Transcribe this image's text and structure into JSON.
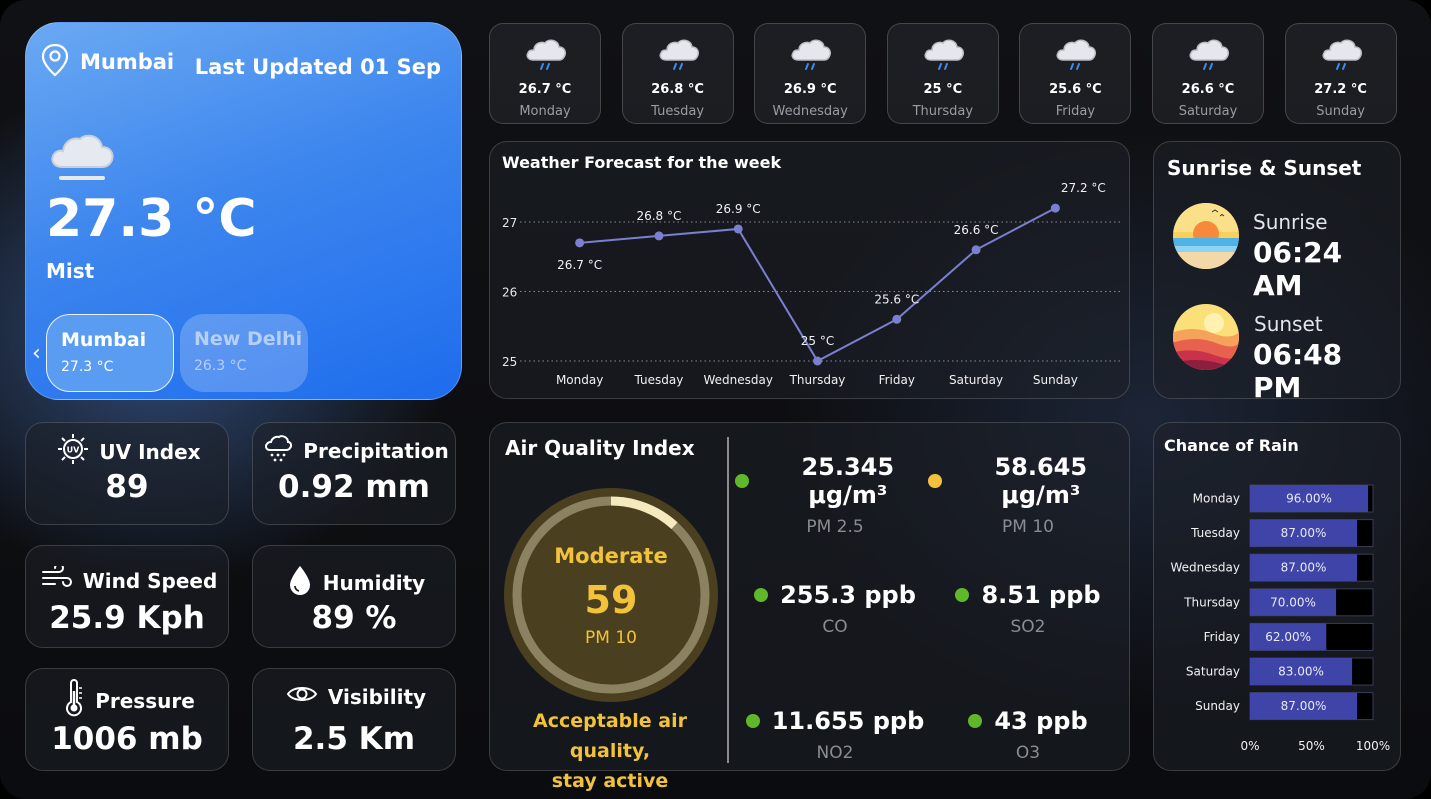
{
  "hero": {
    "location": "Mumbai",
    "last_updated": "Last Updated 01 Sep",
    "temperature": "27.3 °C",
    "condition": "Mist",
    "cities": [
      {
        "name": "Mumbai",
        "temp": "27.3 °C"
      },
      {
        "name": "New Delhi",
        "temp": "26.3 °C"
      }
    ]
  },
  "days": [
    {
      "day": "Monday",
      "temp": "26.7 °C"
    },
    {
      "day": "Tuesday",
      "temp": "26.8 °C"
    },
    {
      "day": "Wednesday",
      "temp": "26.9 °C"
    },
    {
      "day": "Thursday",
      "temp": "25 °C"
    },
    {
      "day": "Friday",
      "temp": "25.6 °C"
    },
    {
      "day": "Saturday",
      "temp": "26.6 °C"
    },
    {
      "day": "Sunday",
      "temp": "27.2 °C"
    }
  ],
  "forecast": {
    "title": "Weather Forecast for the week"
  },
  "sun": {
    "title": "Sunrise & Sunset",
    "sunrise_label": "Sunrise",
    "sunrise_time": "06:24 AM",
    "sunset_label": "Sunset",
    "sunset_time": "06:48 PM"
  },
  "stats": {
    "uv": {
      "label": "UV Index",
      "value": "89"
    },
    "precip": {
      "label": "Precipitation",
      "value": "0.92 mm"
    },
    "wind": {
      "label": "Wind Speed",
      "value": "25.9 Kph"
    },
    "humidity": {
      "label": "Humidity",
      "value": "89 %"
    },
    "pressure": {
      "label": "Pressure",
      "value": "1006 mb"
    },
    "visibility": {
      "label": "Visibility",
      "value": "2.5 Km"
    }
  },
  "aqi": {
    "title": "Air Quality Index",
    "level": "Moderate",
    "value": "59",
    "pollutant": "PM 10",
    "gauge_fraction": 0.118,
    "message_line1": "Acceptable air quality,",
    "message_line2": "stay active",
    "pollutants": [
      {
        "value": "25.345 μg/m³",
        "name": "PM 2.5",
        "color": "#5fb82a"
      },
      {
        "value": "58.645 μg/m³",
        "name": "PM 10",
        "color": "#f1c23a"
      },
      {
        "value": "255.3 ppb",
        "name": "CO",
        "color": "#5fb82a"
      },
      {
        "value": "8.51 ppb",
        "name": "SO2",
        "color": "#5fb82a"
      },
      {
        "value": "11.655 ppb",
        "name": "NO2",
        "color": "#5fb82a"
      },
      {
        "value": "43 ppb",
        "name": "O3",
        "color": "#5fb82a"
      }
    ]
  },
  "rain": {
    "title": "Chance of Rain"
  },
  "colors": {
    "accent_blue": "#1e6ced",
    "line": "#7b7fd0",
    "bar": "#3f44a8",
    "aqi_yellow": "#f1c23a",
    "good_green": "#5fb82a"
  },
  "chart_data": [
    {
      "type": "line",
      "title": "Weather Forecast for the week",
      "categories": [
        "Monday",
        "Tuesday",
        "Wednesday",
        "Thursday",
        "Friday",
        "Saturday",
        "Sunday"
      ],
      "values": [
        26.7,
        26.8,
        26.9,
        25.0,
        25.6,
        26.6,
        27.2
      ],
      "data_labels": [
        "26.7 °C",
        "26.8 °C",
        "26.9 °C",
        "25 °C",
        "25.6 °C",
        "26.6 °C",
        "27.2 °C"
      ],
      "yticks": [
        "25",
        "26",
        "27"
      ],
      "ylim": [
        25,
        27
      ],
      "grid": true
    },
    {
      "type": "bar",
      "orientation": "horizontal",
      "title": "Chance of Rain",
      "categories": [
        "Monday",
        "Tuesday",
        "Wednesday",
        "Thursday",
        "Friday",
        "Saturday",
        "Sunday"
      ],
      "values": [
        96,
        87,
        87,
        70,
        62,
        83,
        87
      ],
      "data_labels": [
        "96.00%",
        "87.00%",
        "87.00%",
        "70.00%",
        "62.00%",
        "83.00%",
        "87.00%"
      ],
      "xticks": [
        "0%",
        "50%",
        "100%"
      ],
      "xlim": [
        0,
        100
      ]
    }
  ]
}
